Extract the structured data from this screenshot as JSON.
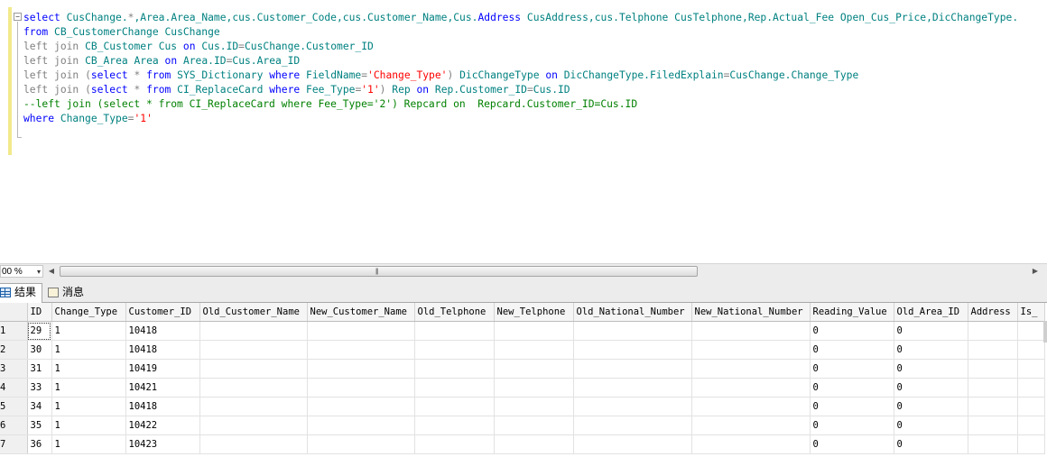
{
  "editor": {
    "line1": "select CusChange.*,Area.Area_Name,cus.Customer_Code,cus.Customer_Name,Cus.Address CusAddress,cus.Telphone CusTelphone,Rep.Actual_Fee Open_Cus_Price,DicChangeType.",
    "line2": "from CB_CustomerChange CusChange",
    "line3": "left join CB_Customer Cus on Cus.ID=CusChange.Customer_ID",
    "line4": "left join CB_Area Area on Area.ID=Cus.Area_ID",
    "line5": "left join (select * from SYS_Dictionary where FieldName='Change_Type') DicChangeType on DicChangeType.FiledExplain=CusChange.Change_Type",
    "line6": "left join (select * from CI_ReplaceCard where Fee_Type='1') Rep on Rep.Customer_ID=Cus.ID",
    "line7": "--left join (select * from CI_ReplaceCard where Fee_Type='2') Repcard on  Repcard.Customer_ID=Cus.ID",
    "line8": "where Change_Type='1'"
  },
  "statusbar": {
    "zoom": "00 %",
    "zoom_arrow": "▾",
    "scroll_left": "◀",
    "scroll_right": "▶",
    "thumb_grip": "|||"
  },
  "tabs": [
    {
      "label": "结果",
      "icon": "grid-icon"
    },
    {
      "label": "消息",
      "icon": "messages-icon"
    }
  ],
  "grid": {
    "columns": [
      "ID",
      "Change_Type",
      "Customer_ID",
      "Old_Customer_Name",
      "New_Customer_Name",
      "Old_Telphone",
      "New_Telphone",
      "Old_National_Number",
      "New_National_Number",
      "Reading_Value",
      "Old_Area_ID",
      "Address",
      "Is_"
    ],
    "rows": [
      [
        "1",
        "29",
        "1",
        "10418",
        "",
        "",
        "",
        "",
        "",
        "",
        "0",
        "0",
        "",
        ""
      ],
      [
        "2",
        "30",
        "1",
        "10418",
        "",
        "",
        "",
        "",
        "",
        "",
        "0",
        "0",
        "",
        ""
      ],
      [
        "3",
        "31",
        "1",
        "10419",
        "",
        "",
        "",
        "",
        "",
        "",
        "0",
        "0",
        "",
        ""
      ],
      [
        "4",
        "33",
        "1",
        "10421",
        "",
        "",
        "",
        "",
        "",
        "",
        "0",
        "0",
        "",
        ""
      ],
      [
        "5",
        "34",
        "1",
        "10418",
        "",
        "",
        "",
        "",
        "",
        "",
        "0",
        "0",
        "",
        ""
      ],
      [
        "6",
        "35",
        "1",
        "10422",
        "",
        "",
        "",
        "",
        "",
        "",
        "0",
        "0",
        "",
        ""
      ],
      [
        "7",
        "36",
        "1",
        "10423",
        "",
        "",
        "",
        "",
        "",
        "",
        "0",
        "0",
        "",
        ""
      ]
    ]
  }
}
